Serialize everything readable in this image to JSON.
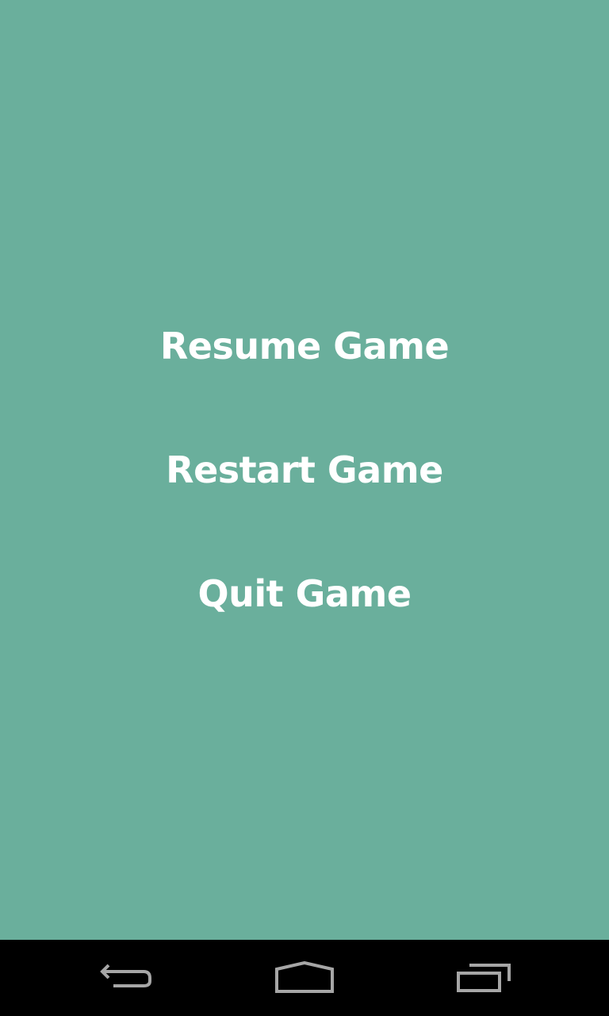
{
  "menu": {
    "items": [
      {
        "label": "Resume Game"
      },
      {
        "label": "Restart Game"
      },
      {
        "label": "Quit Game"
      }
    ]
  },
  "navbar": {
    "buttons": [
      {
        "icon": "back-icon"
      },
      {
        "icon": "home-icon"
      },
      {
        "icon": "recent-apps-icon"
      }
    ]
  },
  "colors": {
    "background": "#6aaf9c",
    "text": "#ffffff",
    "navbar": "#000000",
    "nav_icon": "#a6a6a6"
  }
}
